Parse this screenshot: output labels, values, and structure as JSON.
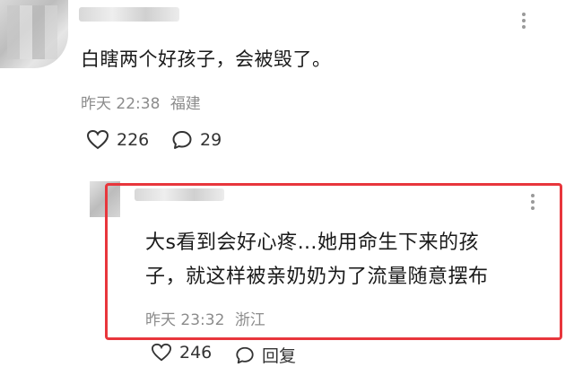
{
  "comments": [
    {
      "text": "白瞎两个好孩子，会被毁了。",
      "time": "昨天 22:38",
      "location": "福建",
      "likes": "226",
      "replies": "29"
    }
  ],
  "reply": {
    "line1": "大s看到会好心疼…她用命生下来的孩",
    "line2": "子，就这样被亲奶奶为了流量随意摆布",
    "time": "昨天 23:32",
    "location": "浙江",
    "likes": "246",
    "reply_label": "回复"
  },
  "colors": {
    "highlight": "#e8363c",
    "meta": "#8c8c8c"
  }
}
